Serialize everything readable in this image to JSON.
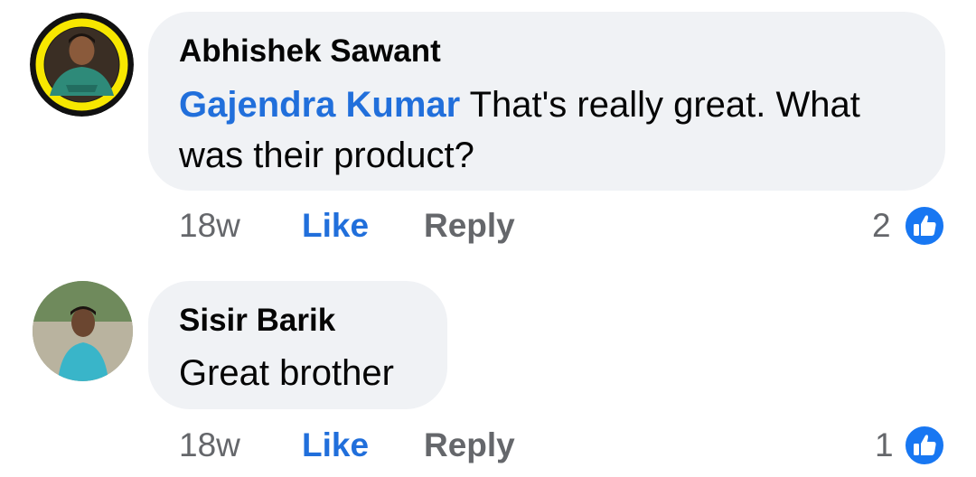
{
  "comments": [
    {
      "author": "Abhishek Sawant",
      "mention": "Gajendra Kumar",
      "text_line1": " That's really great. What",
      "text_line2": "was their product?",
      "time": "18w",
      "like_label": "Like",
      "reply_label": "Reply",
      "reaction_count": "2",
      "reaction_icon": "thumbs-up-icon"
    },
    {
      "author": "Sisir Barik",
      "text_line1": "Great brother",
      "time": "18w",
      "like_label": "Like",
      "reply_label": "Reply",
      "reaction_count": "1",
      "reaction_icon": "thumbs-up-icon"
    }
  ],
  "colors": {
    "bubble": "#f0f2f5",
    "accent": "#216fdb",
    "muted": "#65676b",
    "text": "#050505",
    "avatar1_ring": "#f7e700"
  }
}
